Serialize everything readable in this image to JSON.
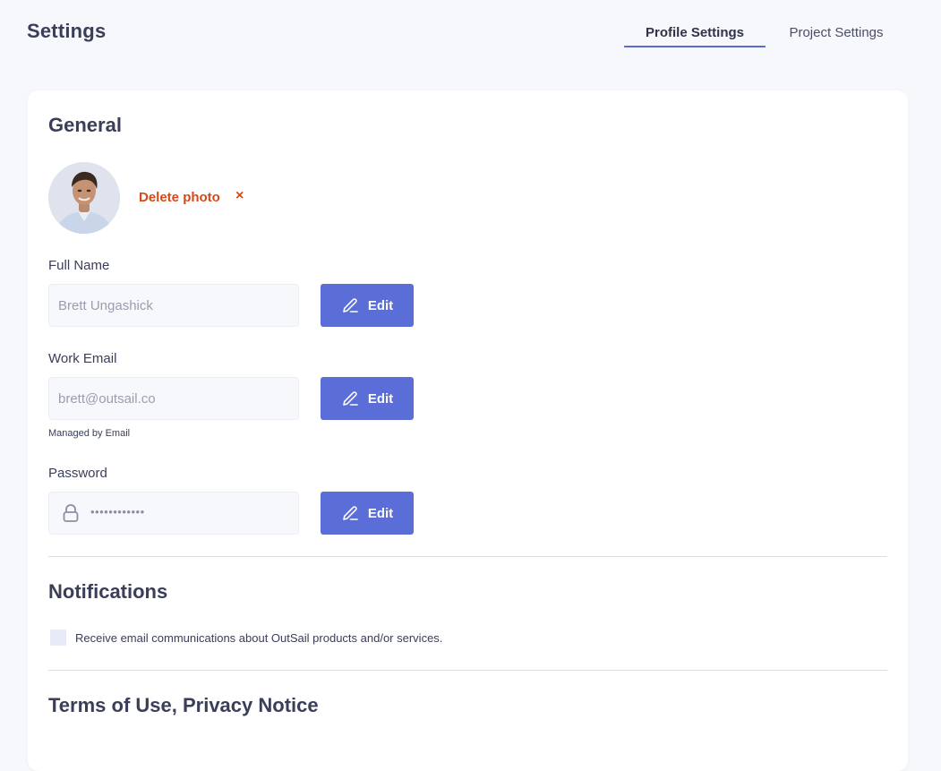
{
  "header": {
    "title": "Settings",
    "tabs": [
      {
        "label": "Profile Settings",
        "active": true
      },
      {
        "label": "Project Settings",
        "active": false
      }
    ]
  },
  "general": {
    "title": "General",
    "delete_photo_label": "Delete photo",
    "delete_icon": "×",
    "full_name": {
      "label": "Full Name",
      "value": "Brett Ungashick",
      "edit_label": "Edit"
    },
    "work_email": {
      "label": "Work Email",
      "value": "brett@outsail.co",
      "helper": "Managed by Email",
      "edit_label": "Edit"
    },
    "password": {
      "label": "Password",
      "masked_value": "••••••••••••",
      "edit_label": "Edit"
    }
  },
  "notifications": {
    "title": "Notifications",
    "checkbox_label": "Receive email communications about OutSail products and/or services.",
    "checked": false
  },
  "terms": {
    "title": "Terms of Use, Privacy Notice"
  },
  "colors": {
    "accent": "#5b6ed8",
    "danger": "#d64a19",
    "text": "#3a3e58",
    "background": "#f7f8fc"
  }
}
